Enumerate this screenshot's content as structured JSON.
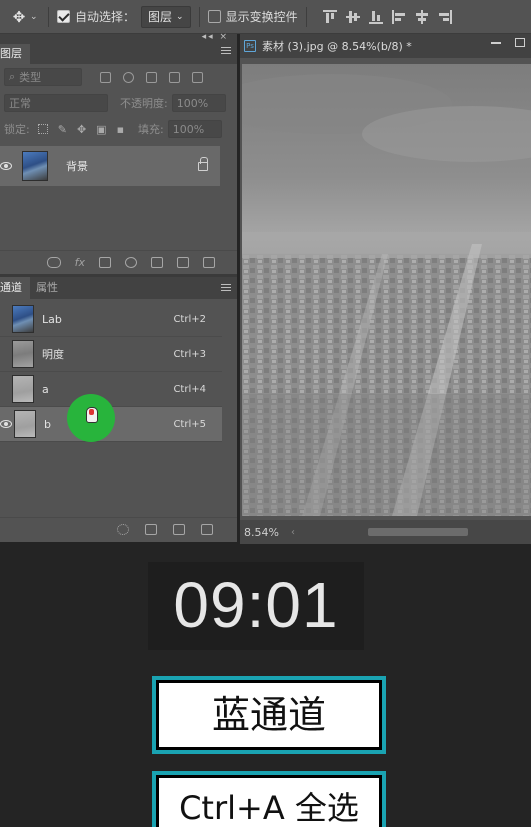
{
  "options_bar": {
    "auto_select_label": "自动选择：",
    "auto_select_checked": true,
    "auto_select_target": "图层",
    "show_transform_label": "显示变换控件",
    "show_transform_checked": false
  },
  "layers_panel": {
    "tab_label": "图层",
    "filter_placeholder": "类型",
    "blend_mode": "正常",
    "opacity_label": "不透明度:",
    "opacity_value": "100%",
    "lock_label": "锁定:",
    "fill_label": "填充:",
    "fill_value": "100%",
    "layers": [
      {
        "name": "背景",
        "visible": true,
        "locked": true
      }
    ]
  },
  "channels_panel": {
    "tabs": [
      "通道",
      "属性"
    ],
    "channels": [
      {
        "name": "Lab",
        "shortcut": "Ctrl+2",
        "visible": false,
        "selected": false
      },
      {
        "name": "明度",
        "shortcut": "Ctrl+3",
        "visible": false,
        "selected": false
      },
      {
        "name": "a",
        "shortcut": "Ctrl+4",
        "visible": false,
        "selected": false
      },
      {
        "name": "b",
        "shortcut": "Ctrl+5",
        "visible": true,
        "selected": true
      }
    ]
  },
  "document": {
    "tab_title": "素材 (3).jpg @ 8.54%(b/8) *",
    "zoom": "8.54%"
  },
  "overlay": {
    "timer": "09:01",
    "caption_1": "蓝通道",
    "caption_2": "Ctrl+A 全选"
  },
  "colors": {
    "panel_bg": "#535353",
    "accent_cursor": "#28b43c",
    "caption_border": "#1aa3b2"
  }
}
